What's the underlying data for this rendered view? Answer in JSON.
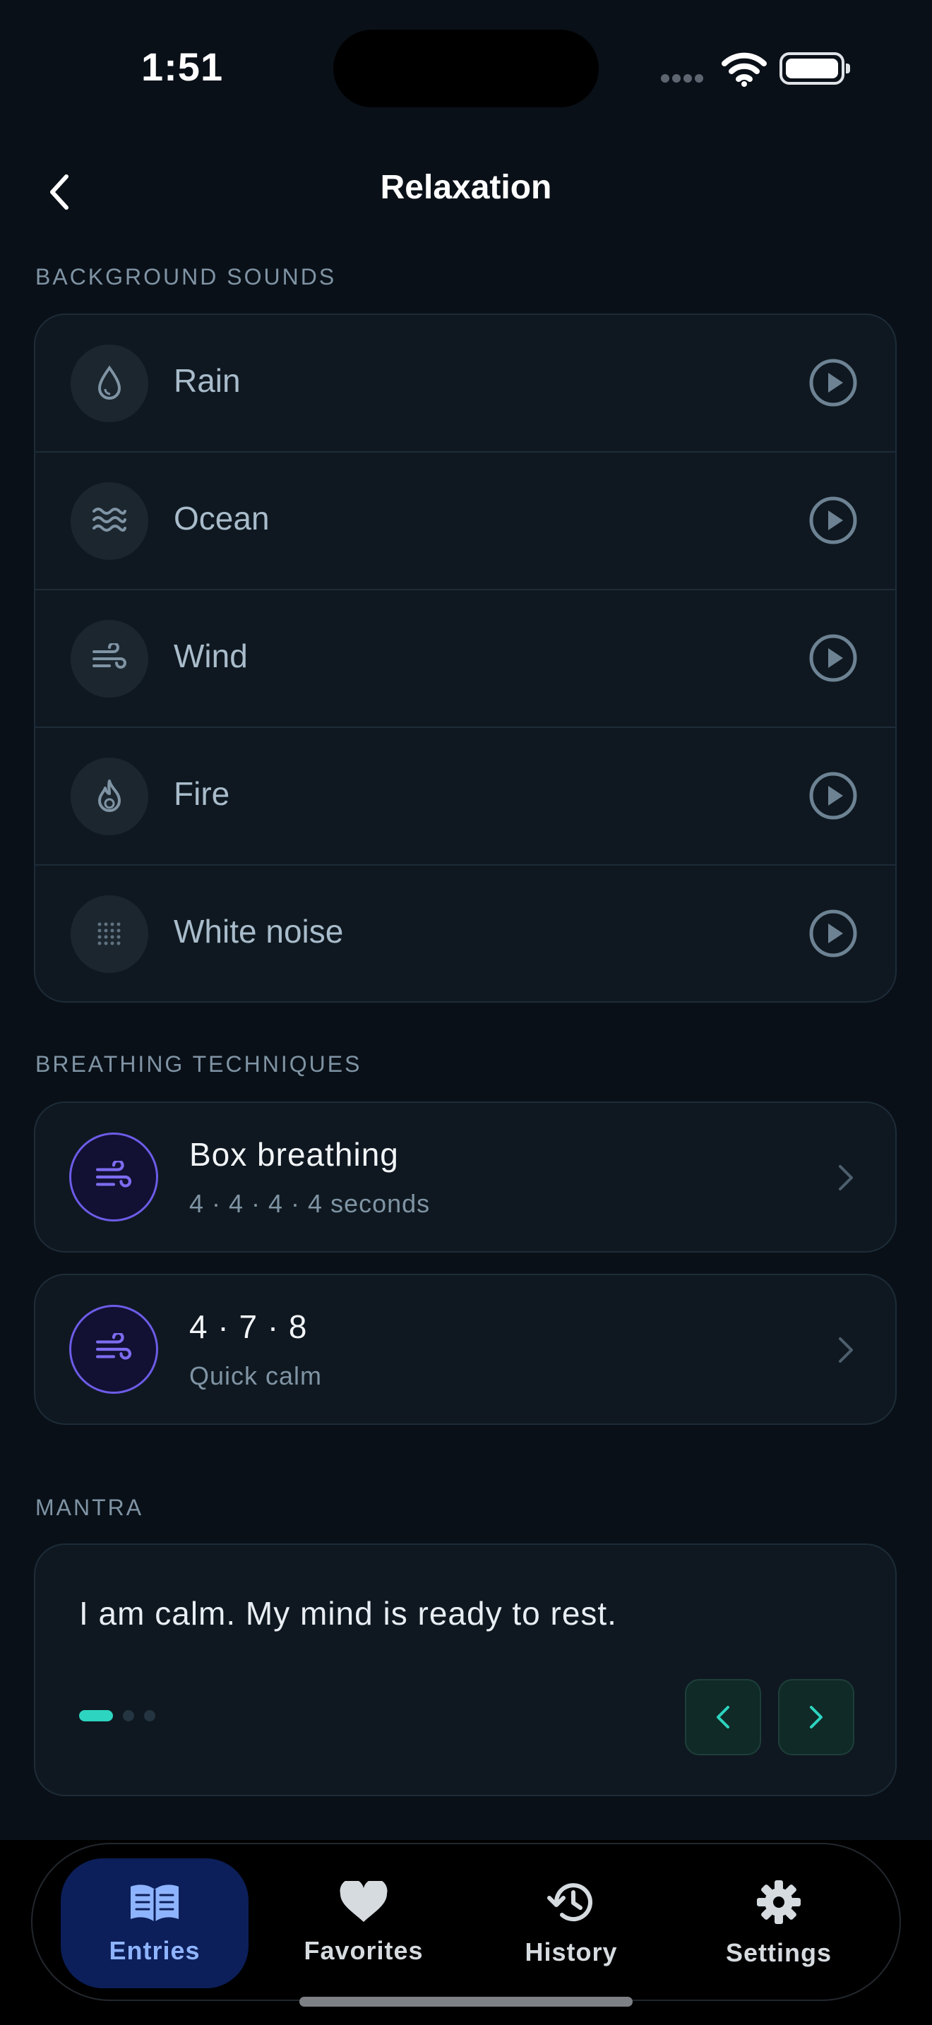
{
  "status_bar": {
    "time": "1:51"
  },
  "header": {
    "title": "Relaxation"
  },
  "background_sounds": {
    "label": "BACKGROUND SOUNDS",
    "items": [
      {
        "label": "Rain",
        "icon": "droplet-icon"
      },
      {
        "label": "Ocean",
        "icon": "waves-icon"
      },
      {
        "label": "Wind",
        "icon": "wind-icon"
      },
      {
        "label": "Fire",
        "icon": "flame-icon"
      },
      {
        "label": "White noise",
        "icon": "noise-dots-icon"
      }
    ]
  },
  "breathing": {
    "label": "BREATHING TECHNIQUES",
    "items": [
      {
        "title": "Box breathing",
        "subtitle": "4 · 4 · 4 · 4 seconds",
        "icon": "wind-icon"
      },
      {
        "title": "4 · 7 · 8",
        "subtitle": "Quick calm",
        "icon": "wind-icon"
      }
    ]
  },
  "mantra": {
    "label": "MANTRA",
    "text": "I am calm. My mind is ready to rest.",
    "page_count": 3,
    "current_page": 1
  },
  "tabs": [
    {
      "label": "Entries",
      "icon": "book-icon",
      "active": true
    },
    {
      "label": "Favorites",
      "icon": "heart-icon",
      "active": false
    },
    {
      "label": "History",
      "icon": "history-icon",
      "active": false
    },
    {
      "label": "Settings",
      "icon": "gear-icon",
      "active": false
    }
  ],
  "colors": {
    "background": "#0a1018",
    "card": "#0f1820",
    "accent_teal": "#2dd4bf",
    "accent_purple": "#6c5ce7",
    "active_tab": "#0c1f5a"
  }
}
